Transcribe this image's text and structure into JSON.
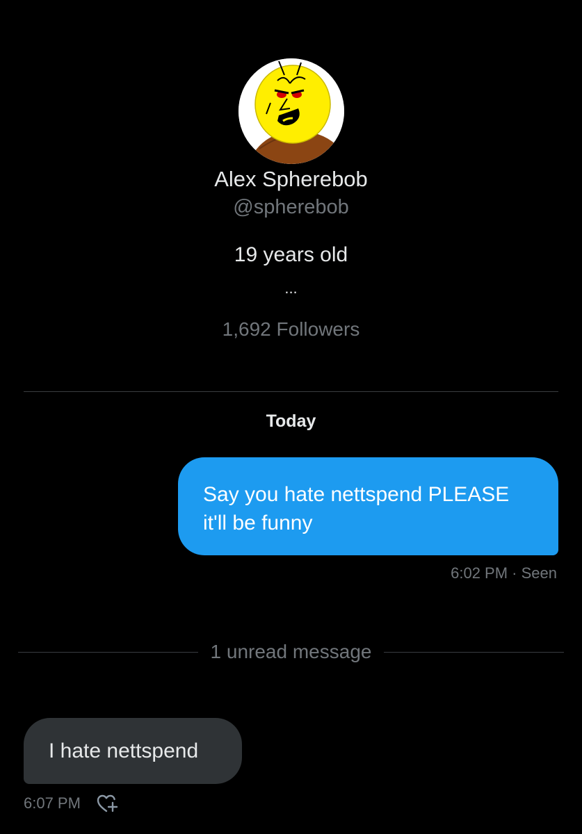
{
  "profile": {
    "name": "Alex Spherebob",
    "handle": "@spherebob",
    "bio": "19 years old",
    "bio_more": "...",
    "followers": "1,692 Followers",
    "avatar_icon": "yellow-sphere-character-avatar"
  },
  "conversation": {
    "date_label": "Today",
    "outgoing_message": {
      "text": "Say you hate nettspend PLEASE it'll be funny",
      "meta": "6:02 PM · Seen"
    },
    "unread_label": "1 unread message",
    "incoming_message": {
      "text": "I hate nettspend",
      "time": "6:07 PM",
      "reaction_icon": "add-reaction-heart-icon"
    }
  },
  "colors": {
    "background": "#000000",
    "outgoing_bubble": "#1d9bf0",
    "incoming_bubble": "#2f3336",
    "primary_text": "#e7e9ea",
    "secondary_text": "#71767b"
  }
}
